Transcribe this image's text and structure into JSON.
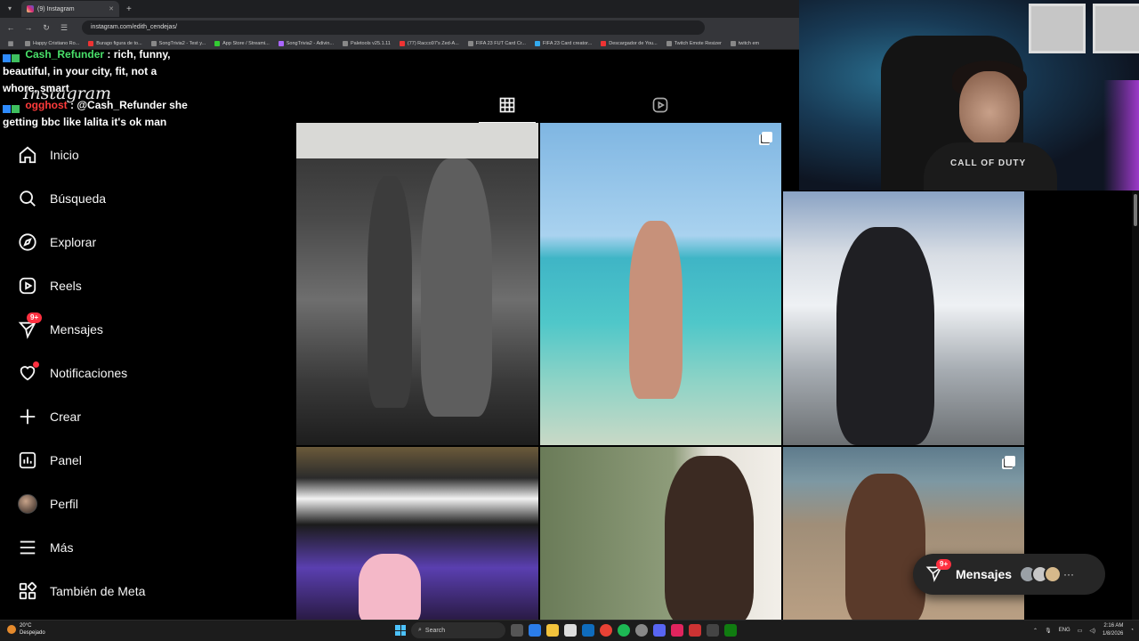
{
  "browser": {
    "tab_title": "(9) Instagram",
    "url": "instagram.com/edith_cendejas/",
    "bookmarks": [
      "Happy Cristiano Ro...",
      "Burago figura de to...",
      "SongTrivia2 - Test y...",
      "App Store / Streami...",
      "SongTrivia2 - Adivin...",
      "Paletools v25.1.11",
      "(77) Racco97's Zed-A...",
      "FIFA 23 FUT Card Cr...",
      "FIFA 23 Card creator...",
      "Descargador de You...",
      "Twitch Emote Resizer",
      "twitch em"
    ]
  },
  "instagram": {
    "logo": "Instagram",
    "sidebar": {
      "items": [
        {
          "label": "Inicio",
          "icon": "home-icon"
        },
        {
          "label": "Búsqueda",
          "icon": "search-icon"
        },
        {
          "label": "Explorar",
          "icon": "compass-icon"
        },
        {
          "label": "Reels",
          "icon": "reels-icon"
        },
        {
          "label": "Mensajes",
          "icon": "messenger-icon",
          "badge": "9+"
        },
        {
          "label": "Notificaciones",
          "icon": "heart-icon"
        },
        {
          "label": "Crear",
          "icon": "plus-icon"
        },
        {
          "label": "Panel",
          "icon": "chart-icon"
        },
        {
          "label": "Perfil",
          "icon": "avatar"
        },
        {
          "label": "Más",
          "icon": "menu-icon"
        },
        {
          "label": "También de Meta",
          "icon": "meta-apps-icon"
        }
      ]
    },
    "profile_tabs": [
      "grid-icon",
      "reels-icon"
    ],
    "messages_pill": {
      "label": "Mensajes",
      "badge": "9+"
    }
  },
  "chat": [
    {
      "user": "Cash_Refunder",
      "message": ": rich, funny, beautiful, in your city, fit, not a whore, smart",
      "color": "#49e06a"
    },
    {
      "user": "ogghost",
      "message": ": @Cash_Refunder she getting bbc like lalita it's ok man",
      "color": "#ff3b3b"
    }
  ],
  "webcam": {
    "shirt_text": "CALL OF DUTY"
  },
  "taskbar": {
    "weather_temp": "20°C",
    "weather_desc": "Despejado",
    "search_label": "Search",
    "language": "ENG",
    "time": "2:16 AM",
    "date": "1/8/2026"
  },
  "colors": {
    "accent_badge": "#ff3040",
    "background": "#000000"
  }
}
